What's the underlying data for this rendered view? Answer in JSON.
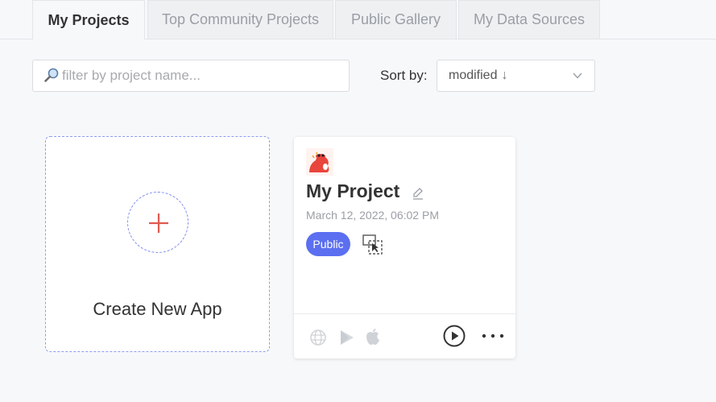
{
  "tabs": [
    {
      "label": "My Projects",
      "active": true
    },
    {
      "label": "Top Community Projects",
      "active": false
    },
    {
      "label": "Public Gallery",
      "active": false
    },
    {
      "label": "My Data Sources",
      "active": false
    }
  ],
  "filter": {
    "placeholder": "filter by project name...",
    "value": "",
    "icon": "magnifier-icon"
  },
  "sort": {
    "label": "Sort by:",
    "selected": "modified",
    "direction_glyph": "↓"
  },
  "create_card": {
    "label": "Create New App",
    "accent": "#e05a4f"
  },
  "projects": [
    {
      "name": "My Project",
      "date": "March 12, 2022, 06:02 PM",
      "badge": "Public",
      "badge_color": "#5b6ff0",
      "footer_icons": [
        "globe-icon",
        "google-play-icon",
        "apple-icon",
        "play-circle-icon",
        "more-icon"
      ]
    }
  ]
}
